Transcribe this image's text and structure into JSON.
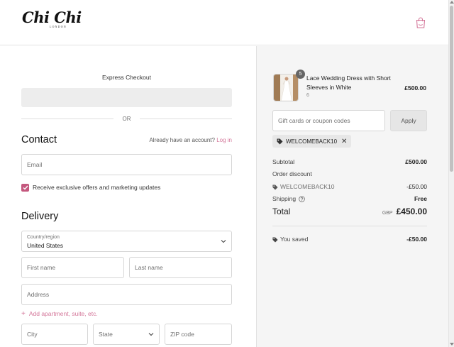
{
  "header": {
    "logo_text": "Chi Chi",
    "logo_subtext": "LONDON",
    "cart_icon": "shopping-bag-icon"
  },
  "express": {
    "title": "Express Checkout",
    "divider_text": "OR"
  },
  "contact": {
    "title": "Contact",
    "account_prompt": "Already have an account?",
    "login_link": "Log in",
    "email_placeholder": "Email",
    "marketing_label": "Receive exclusive offers and marketing updates",
    "marketing_checked": true
  },
  "delivery": {
    "title": "Delivery",
    "country_label": "Country/region",
    "country_value": "United States",
    "first_name_placeholder": "First name",
    "last_name_placeholder": "Last name",
    "address_placeholder": "Address",
    "add_apartment": "Add apartment, suite, etc.",
    "city_placeholder": "City",
    "state_placeholder": "State",
    "zip_placeholder": "ZIP code"
  },
  "summary": {
    "product": {
      "name": "Lace Wedding Dress with Short Sleeves in White",
      "variant": "6",
      "quantity": "5",
      "price": "£500.00"
    },
    "coupon_placeholder": "Gift cards or coupon codes",
    "apply_label": "Apply",
    "applied_code": "WELCOMEBACK10",
    "subtotal_label": "Subtotal",
    "subtotal_value": "£500.00",
    "order_discount_label": "Order discount",
    "discount_code": "WELCOMEBACK10",
    "discount_value": "-£50.00",
    "shipping_label": "Shipping",
    "shipping_value": "Free",
    "total_label": "Total",
    "total_currency": "GBP",
    "total_value": "£450.00",
    "saved_label": "You saved",
    "saved_value": "-£50.00"
  },
  "colors": {
    "accent_pink": "#d4779a",
    "checkbox": "#c4587e",
    "summary_bg": "#f5f5f5"
  }
}
